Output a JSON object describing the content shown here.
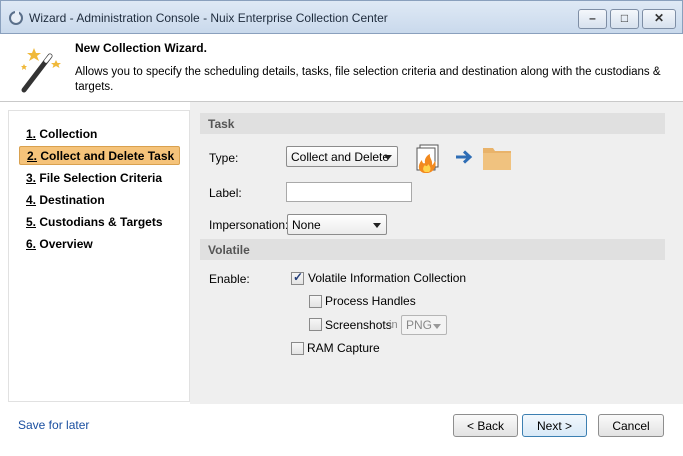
{
  "window": {
    "title": "Wizard - Administration Console - Nuix Enterprise Collection Center"
  },
  "header": {
    "title": "New Collection Wizard.",
    "description": "Allows you to specify the scheduling details, tasks, file selection criteria and destination along with the custodians & targets."
  },
  "nav": {
    "items": [
      {
        "num": "1.",
        "label": "Collection",
        "active": false
      },
      {
        "num": "2.",
        "label": "Collect and Delete Task",
        "active": true
      },
      {
        "num": "3.",
        "label": "File Selection Criteria",
        "active": false
      },
      {
        "num": "4.",
        "label": "Destination",
        "active": false
      },
      {
        "num": "5.",
        "label": "Custodians & Targets",
        "active": false
      },
      {
        "num": "6.",
        "label": "Overview",
        "active": false
      }
    ]
  },
  "save_later": "Save for later",
  "task": {
    "section": "Task",
    "type_label": "Type:",
    "type_value": "Collect and Delete",
    "label_label": "Label:",
    "label_value": "",
    "impersonation_label": "Impersonation:",
    "impersonation_value": "None"
  },
  "volatile": {
    "section": "Volatile",
    "enable_label": "Enable:",
    "volatile_info": {
      "label": "Volatile Information Collection",
      "checked": true
    },
    "process_handles": {
      "label": "Process Handles",
      "checked": false
    },
    "screenshots": {
      "label": "Screenshots",
      "checked": false
    },
    "in_label": "in",
    "format_value": "PNG",
    "ram_capture": {
      "label": "RAM Capture",
      "checked": false
    }
  },
  "buttons": {
    "back": "< Back",
    "next": "Next >",
    "cancel": "Cancel"
  },
  "colors": {
    "active_nav": "#f5c37a",
    "link": "#1a4fa0",
    "arrow_icon": "#2e6db5",
    "folder_icon": "#e9b36a"
  },
  "icons": [
    "app-icon",
    "magic-wand-icon",
    "document-fire-icon",
    "right-arrow-icon",
    "folder-icon"
  ]
}
